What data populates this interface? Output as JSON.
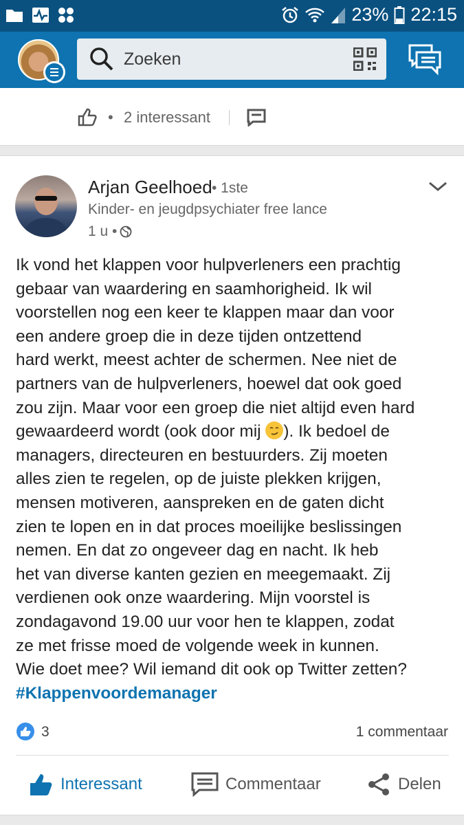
{
  "status_bar": {
    "battery": "23%",
    "time": "22:15"
  },
  "search": {
    "placeholder": "Zoeken"
  },
  "previous_post": {
    "interesting_count": "2 interessant",
    "dot": "•"
  },
  "post": {
    "author": "Arjan Geelhoed",
    "degree": "• 1ste",
    "headline": "Kinder- en jeugdpsychiater free lance",
    "time": "1 u •",
    "body_part1": "Ik vond het klappen voor hulpverleners een prachtig\ngebaar van waardering en saamhorigheid. Ik wil\nvoorstellen nog een keer te klappen maar dan voor\neen andere groep die in deze tijden ontzettend\nhard werkt, meest achter de schermen. Nee niet de\npartners van de hulpverleners, hoewel dat ook goed\nzou zijn. Maar voor een groep die niet altijd even hard\ngewaardeerd wordt (ook door mij ",
    "body_part2": "). Ik bedoel de\nmanagers, directeuren en bestuurders. Zij moeten\nalles zien te regelen, op de juiste plekken krijgen,\nmensen motiveren, aanspreken en de gaten dicht\nzien te lopen en in dat proces moeilijke beslissingen\nnemen. En dat zo ongeveer dag en nacht. Ik heb\nhet van diverse kanten gezien en meegemaakt. Zij\nverdienen ook onze waardering. Mijn voorstel is\nzondagavond 19.00 uur voor hen te klappen, zodat\nze met frisse moed de volgende week in kunnen.\nWie doet mee? Wil iemand dit ook op Twitter zetten?\n",
    "hashtag": "#Klappenvoordemanager",
    "reaction_count": "3",
    "comment_count": "1 commentaar"
  },
  "actions": {
    "like": "Interessant",
    "comment": "Commentaar",
    "share": "Delen"
  },
  "colors": {
    "status_bar": "#0a5180",
    "app_bar": "#0e73b0",
    "accent": "#0e73b0"
  }
}
